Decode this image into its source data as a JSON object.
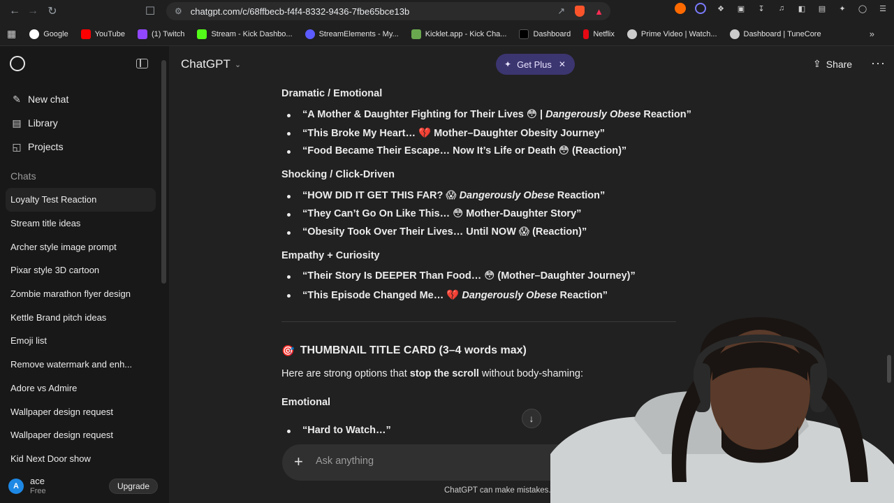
{
  "browser": {
    "url": "chatgpt.com/c/68ffbecb-f4f4-8332-9436-7fbe65bce13b",
    "bookmarks": [
      {
        "label": "Google",
        "color": "#ffffff"
      },
      {
        "label": "YouTube",
        "color": "#ff0000"
      },
      {
        "label": "(1) Twitch",
        "color": "#9146ff"
      },
      {
        "label": "Stream - Kick Dashbo...",
        "color": "#53fc18"
      },
      {
        "label": "StreamElements - My...",
        "color": "#5b5bff"
      },
      {
        "label": "Kicklet.app - Kick Cha...",
        "color": "#6aa84f"
      },
      {
        "label": "Dashboard",
        "color": "#000000"
      },
      {
        "label": "Netflix",
        "color": "#e50914"
      },
      {
        "label": "Prime Video | Watch...",
        "color": "#cccccc"
      },
      {
        "label": "Dashboard | TuneCore",
        "color": "#cccccc"
      }
    ]
  },
  "sidebar": {
    "nav": [
      {
        "label": "New chat",
        "icon": "edit-icon"
      },
      {
        "label": "Library",
        "icon": "library-icon"
      },
      {
        "label": "Projects",
        "icon": "folder-icon"
      }
    ],
    "chats_heading": "Chats",
    "chats": [
      "Loyalty Test Reaction",
      "Stream title ideas",
      "Archer style image prompt",
      "Pixar style 3D cartoon",
      "Zombie marathon flyer design",
      "Kettle Brand pitch ideas",
      "Emoji list",
      "Remove watermark and enh...",
      "Adore vs Admire",
      "Wallpaper design request",
      "Wallpaper design request",
      "Kid Next Door show"
    ],
    "user": {
      "initial": "A",
      "name": "ace",
      "plan": "Free",
      "upgrade": "Upgrade"
    }
  },
  "header": {
    "model": "ChatGPT",
    "get_plus": "Get Plus",
    "share": "Share"
  },
  "content": {
    "sections": [
      {
        "heading": "Dramatic / Emotional",
        "items": [
          {
            "pre": "“A Mother & Daughter Fighting for Their Lives 😳 | ",
            "em": "Dangerously Obese",
            "post": " Reaction”"
          },
          {
            "pre": "“This Broke My Heart… 💔 Mother–Daughter Obesity Journey”",
            "em": "",
            "post": ""
          },
          {
            "pre": "“Food Became Their Escape… Now It’s Life or Death 😳 (Reaction)”",
            "em": "",
            "post": ""
          }
        ]
      },
      {
        "heading": "Shocking / Click-Driven",
        "items": [
          {
            "pre": "“HOW DID IT GET THIS FAR? 😱 ",
            "em": "Dangerously Obese",
            "post": " Reaction”"
          },
          {
            "pre": "“They Can’t Go On Like This… 😳 Mother-Daughter Story”",
            "em": "",
            "post": ""
          },
          {
            "pre": "“Obesity Took Over Their Lives… Until NOW 😱 (Reaction)”",
            "em": "",
            "post": ""
          }
        ]
      },
      {
        "heading": "Empathy + Curiosity",
        "items": [
          {
            "pre": "“Their Story Is DEEPER Than Food… 😳 (Mother–Daughter Journey)”",
            "em": "",
            "post": ""
          },
          {
            "pre": "“This Episode Changed Me… 💔 ",
            "em": "Dangerously Obese",
            "post": " Reaction”"
          }
        ]
      }
    ],
    "thumbnail_heading": "THUMBNAIL TITLE CARD (3–4 words max)",
    "thumb_para_pre": "Here are strong options that ",
    "thumb_para_bold": "stop the scroll",
    "thumb_para_post": " without body-shaming:",
    "emotional_heading": "Emotional",
    "emotional_item": "“Hard to Watch…”"
  },
  "composer": {
    "placeholder": "Ask anything"
  },
  "disclaimer": "ChatGPT can make mistakes. C"
}
